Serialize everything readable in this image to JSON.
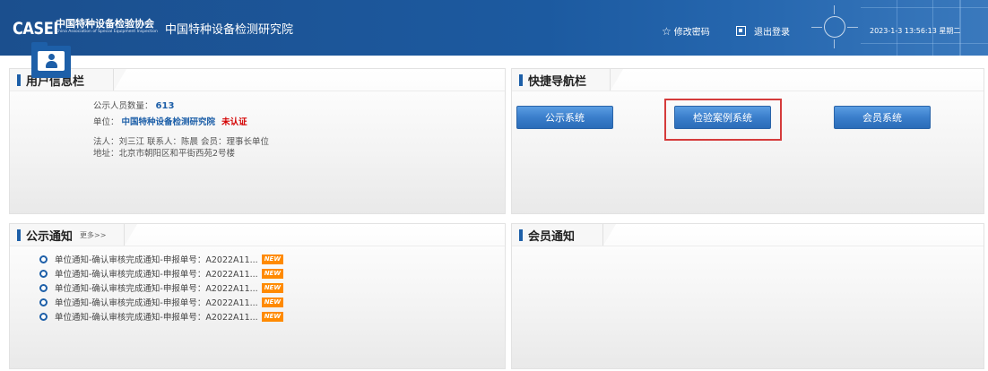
{
  "header": {
    "logo": "CASEI",
    "assoc_cn": "中国特种设备检验协会",
    "assoc_en": "China Association of Special Equipment Inspection",
    "site_title": "中国特种设备检测研究院",
    "change_password": "修改密码",
    "logout": "退出登录",
    "datetime": "2023-1-3 13:56:13 星期二"
  },
  "user_panel": {
    "title": "用户信息栏",
    "count_label": "公示人员数量：",
    "count_value": "613",
    "unit_label": "单位：",
    "unit_value": "中国特种设备检测研究院",
    "unit_status": "未认证",
    "detail_line": "法人：刘三江  联系人：陈晨  会员：理事长单位",
    "address_line": "地址：北京市朝阳区和平街西苑2号楼"
  },
  "nav_panel": {
    "title": "快捷导航栏",
    "buttons": [
      "公示系统",
      "检验案例系统",
      "会员系统"
    ]
  },
  "notice_panel": {
    "title": "公示通知",
    "more": "更多>>",
    "new_badge": "NEW",
    "items": [
      "单位通知-确认审核完成通知-申报单号：A2022A11...",
      "单位通知-确认审核完成通知-申报单号：A2022A11...",
      "单位通知-确认审核完成通知-申报单号：A2022A11...",
      "单位通知-确认审核完成通知-申报单号：A2022A11...",
      "单位通知-确认审核完成通知-申报单号：A2022A11..."
    ]
  },
  "member_panel": {
    "title": "会员通知"
  },
  "colors": {
    "header_blue": "#1c5aa0",
    "accent": "#1d5fa8",
    "warning_red": "#d40000",
    "new_orange": "#ff8a00",
    "highlight_red": "#d53b3b"
  },
  "icons": [
    "star-icon",
    "logout-icon",
    "sun-icon",
    "user-folder-icon",
    "bullet-circle-icon"
  ]
}
